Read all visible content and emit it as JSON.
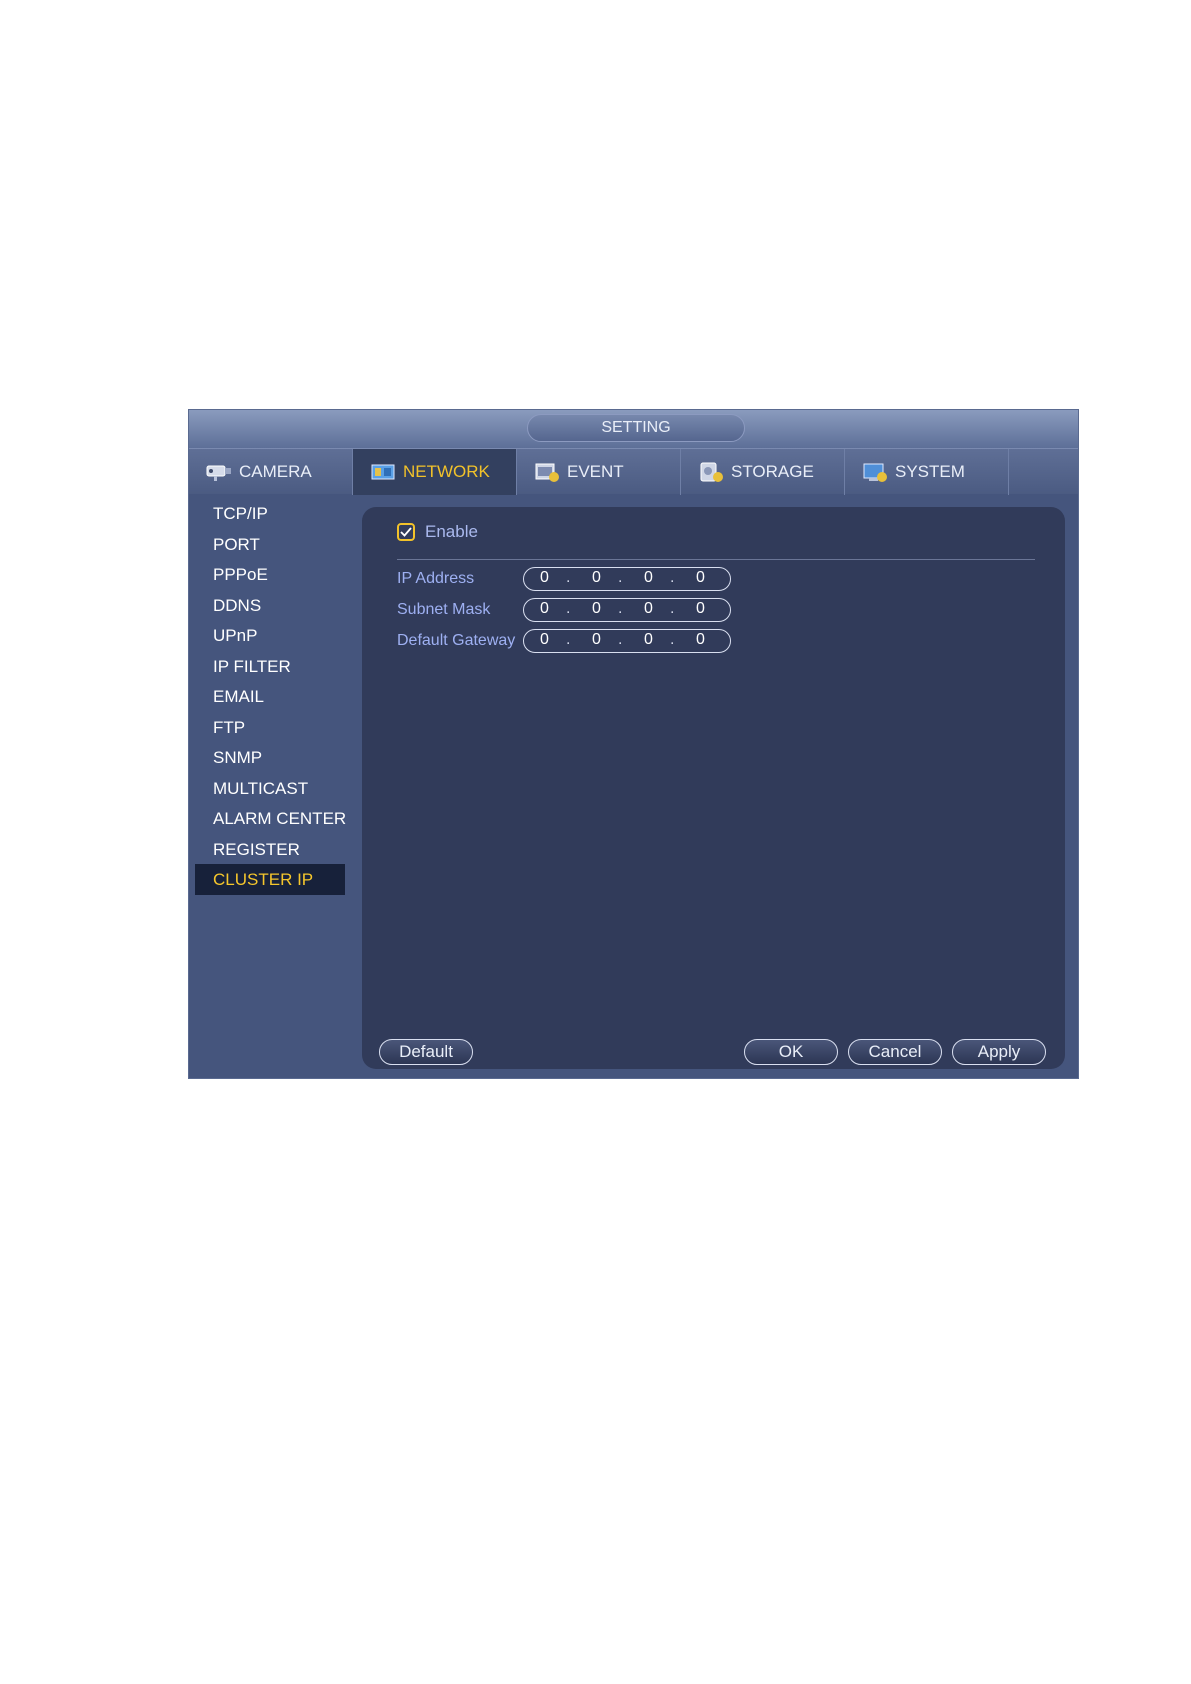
{
  "window": {
    "title": "SETTING"
  },
  "tabs": [
    {
      "label": "CAMERA",
      "icon": "camera-icon",
      "active": false
    },
    {
      "label": "NETWORK",
      "icon": "network-icon",
      "active": true
    },
    {
      "label": "EVENT",
      "icon": "event-icon",
      "active": false
    },
    {
      "label": "STORAGE",
      "icon": "storage-icon",
      "active": false
    },
    {
      "label": "SYSTEM",
      "icon": "system-icon",
      "active": false
    }
  ],
  "sidebar": {
    "items": [
      {
        "label": "TCP/IP"
      },
      {
        "label": "PORT"
      },
      {
        "label": "PPPoE"
      },
      {
        "label": "DDNS"
      },
      {
        "label": "UPnP"
      },
      {
        "label": "IP FILTER"
      },
      {
        "label": "EMAIL"
      },
      {
        "label": "FTP"
      },
      {
        "label": "SNMP"
      },
      {
        "label": "MULTICAST"
      },
      {
        "label": "ALARM CENTER"
      },
      {
        "label": "REGISTER"
      },
      {
        "label": "CLUSTER IP"
      }
    ],
    "selected": "CLUSTER IP"
  },
  "form": {
    "enable": {
      "label": "Enable",
      "checked": true
    },
    "fields": [
      {
        "label": "IP Address",
        "octets": [
          "0",
          "0",
          "0",
          "0"
        ]
      },
      {
        "label": "Subnet Mask",
        "octets": [
          "0",
          "0",
          "0",
          "0"
        ]
      },
      {
        "label": "Default Gateway",
        "octets": [
          "0",
          "0",
          "0",
          "0"
        ]
      }
    ],
    "dot": "."
  },
  "buttons": {
    "default": "Default",
    "ok": "OK",
    "cancel": "Cancel",
    "apply": "Apply"
  },
  "colors": {
    "accent": "#f2c22a",
    "panel": "#313b5a",
    "window": "#45557d",
    "label": "#9eb0f2"
  }
}
